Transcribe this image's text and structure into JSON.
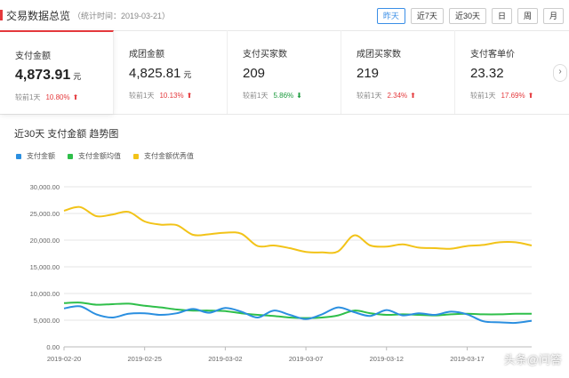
{
  "header": {
    "title": "交易数据总览",
    "subtitle": "（统计时间：2019-03-21）",
    "ranges": [
      {
        "label": "昨天",
        "active": true
      },
      {
        "label": "近7天",
        "active": false
      },
      {
        "label": "近30天",
        "active": false
      },
      {
        "label": "日",
        "active": false
      },
      {
        "label": "周",
        "active": false
      },
      {
        "label": "月",
        "active": false
      }
    ]
  },
  "metrics": [
    {
      "label": "支付金额",
      "value": "4,873.91",
      "unit": "元",
      "compare": "较前1天",
      "pct": "10.80%",
      "dir": "up",
      "active": true
    },
    {
      "label": "成团金额",
      "value": "4,825.81",
      "unit": "元",
      "compare": "较前1天",
      "pct": "10.13%",
      "dir": "up",
      "active": false
    },
    {
      "label": "支付买家数",
      "value": "209",
      "unit": "",
      "compare": "较前1天",
      "pct": "5.86%",
      "dir": "down",
      "active": false
    },
    {
      "label": "成团买家数",
      "value": "219",
      "unit": "",
      "compare": "较前1天",
      "pct": "2.34%",
      "dir": "up",
      "active": false
    },
    {
      "label": "支付客单价",
      "value": "23.32",
      "unit": "",
      "compare": "较前1天",
      "pct": "17.69%",
      "dir": "up",
      "active": false
    }
  ],
  "next_icon": "chevron-right-icon",
  "colors": {
    "accent": "#e4393c",
    "blue": "#2b8fe0",
    "green": "#2fbf4a",
    "yellow": "#f2c318",
    "down": "#1a9a3c"
  },
  "watermark": "头条@问答",
  "chart_data": {
    "type": "line",
    "title": "近30天 支付金额 趋势图",
    "legend_position": "top-left",
    "grid": true,
    "ylim": [
      0,
      30000
    ],
    "y_ticks": [
      "0.00",
      "5,000.00",
      "10,000.00",
      "15,000.00",
      "20,000.00",
      "25,000.00",
      "30,000.00"
    ],
    "x_ticks": [
      "2019-02-20",
      "2019-02-25",
      "2019-03-02",
      "2019-03-07",
      "2019-03-12",
      "2019-03-17"
    ],
    "x": [
      "2019-02-20",
      "2019-02-21",
      "2019-02-22",
      "2019-02-23",
      "2019-02-24",
      "2019-02-25",
      "2019-02-26",
      "2019-02-27",
      "2019-02-28",
      "2019-03-01",
      "2019-03-02",
      "2019-03-03",
      "2019-03-04",
      "2019-03-05",
      "2019-03-06",
      "2019-03-07",
      "2019-03-08",
      "2019-03-09",
      "2019-03-10",
      "2019-03-11",
      "2019-03-12",
      "2019-03-13",
      "2019-03-14",
      "2019-03-15",
      "2019-03-16",
      "2019-03-17",
      "2019-03-18",
      "2019-03-19",
      "2019-03-20",
      "2019-03-21"
    ],
    "series": [
      {
        "name": "支付金额",
        "color": "#2b8fe0",
        "values": [
          7200,
          7600,
          6100,
          5500,
          6200,
          6300,
          6000,
          6300,
          7100,
          6400,
          7300,
          6600,
          5500,
          6800,
          6000,
          5200,
          6100,
          7400,
          6500,
          5800,
          6900,
          5900,
          6300,
          6000,
          6600,
          6100,
          4800,
          4600,
          4500,
          4900
        ]
      },
      {
        "name": "支付金额均值",
        "color": "#2fbf4a",
        "values": [
          8200,
          8300,
          7900,
          8000,
          8100,
          7700,
          7400,
          7000,
          6800,
          6800,
          6700,
          6300,
          6000,
          5800,
          5500,
          5400,
          5500,
          5900,
          6800,
          6300,
          6000,
          6100,
          6000,
          5900,
          6100,
          6200,
          6100,
          6100,
          6200,
          6200
        ]
      },
      {
        "name": "支付金额优秀值",
        "color": "#f2c318",
        "values": [
          25500,
          26200,
          24500,
          24800,
          25300,
          23500,
          22900,
          22800,
          21000,
          21100,
          21400,
          21200,
          18900,
          19000,
          18500,
          17800,
          17700,
          17900,
          20900,
          19000,
          18800,
          19200,
          18600,
          18500,
          18400,
          18900,
          19100,
          19600,
          19600,
          19000
        ]
      }
    ]
  }
}
